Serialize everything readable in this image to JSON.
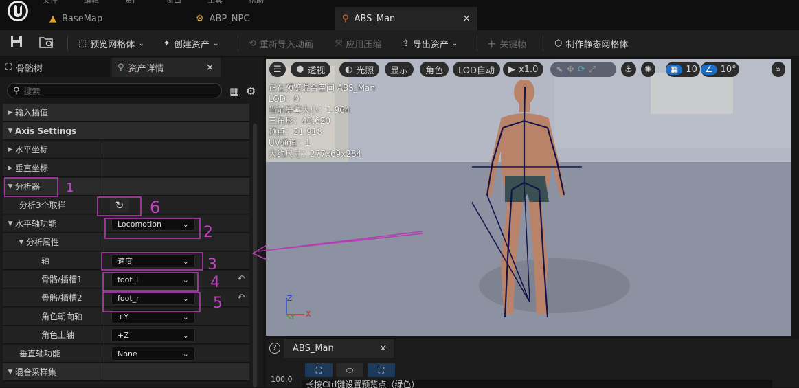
{
  "menu": {
    "items": [
      "文件",
      "编辑",
      "资产",
      "窗口",
      "工具",
      "帮助"
    ]
  },
  "tabs": [
    {
      "label": "BaseMap",
      "icon": "map-icon"
    },
    {
      "label": "ABP_NPC",
      "icon": "anim-blueprint-icon"
    },
    {
      "label": "ABS_Man",
      "icon": "blendspace-icon",
      "close": "×"
    }
  ],
  "toolbar": {
    "preview_mesh": "预览网格体",
    "create_asset": "创建资产",
    "reimport": "重新导入动画",
    "apply_compression": "应用压缩",
    "export_asset": "导出资产",
    "keyframe": "关键帧",
    "make_static_mesh": "制作静态网格体"
  },
  "left_panel": {
    "tab_skeleton": "骨骼树",
    "tab_details": "资产详情",
    "close": "×",
    "search_placeholder": "搜索"
  },
  "details": {
    "input_interp": "输入插值",
    "axis_settings": "Axis Settings",
    "horizontal_axis": "水平坐标",
    "vertical_axis": "垂直坐标",
    "analyzer": "分析器",
    "analyze_3_samples": "分析3个取样",
    "horizontal_axis_function": "水平轴功能",
    "horizontal_axis_function_value": "Locomotion",
    "analysis_properties": "分析属性",
    "axis": "轴",
    "axis_value": "速度",
    "bone_socket_1": "骨骼/插槽1",
    "bone_socket_1_value": "foot_l",
    "bone_socket_2": "骨骼/插槽2",
    "bone_socket_2_value": "foot_r",
    "character_facing_axis": "角色朝向轴",
    "character_facing_axis_value": "+Y",
    "character_up_axis": "角色上轴",
    "character_up_axis_value": "+Z",
    "vertical_axis_function": "垂直轴功能",
    "vertical_axis_function_value": "None",
    "blend_samples": "混合采样集"
  },
  "viewport": {
    "perspective": "透视",
    "lit": "光照",
    "show": "显示",
    "character": "角色",
    "lod_auto": "LOD自动",
    "play_speed": "x1.0",
    "grid_size": "10",
    "rotation_snap": "10°",
    "stats": [
      "正在预览混合空间 ABS_Man",
      "LOD：0",
      "当前屏幕大小：1.964",
      "三角形：40,620",
      "顶点：21,918",
      "UV通道：1",
      "大约尺寸：277x69x284"
    ],
    "axis_z": "Z",
    "axis_y": "Y",
    "axis_x": "X"
  },
  "bottom_panel": {
    "help": "?",
    "tab": "ABS_Man",
    "close": "×",
    "value": "100.0",
    "hint": "长按Ctrl键设置预览点（绿色）"
  },
  "annotations": [
    "1",
    "2",
    "3",
    "4",
    "5",
    "6"
  ],
  "colors": {
    "accent_blue": "#1c6ec6",
    "annotation": "#b43db4",
    "skeleton": "#14144a"
  }
}
